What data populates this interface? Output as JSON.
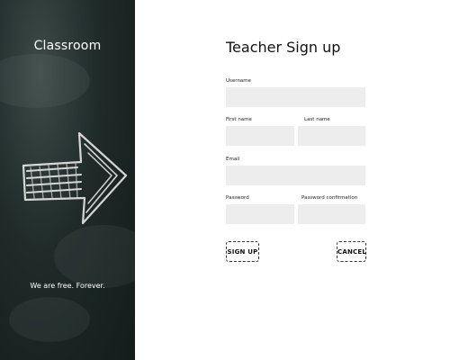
{
  "sidebar": {
    "brand": "Classroom",
    "tagline": "We are free. Forever."
  },
  "form": {
    "title": "Teacher Sign up",
    "username_label": "Username",
    "username_value": "",
    "first_name_label": "First name",
    "first_name_value": "",
    "last_name_label": "Last name",
    "last_name_value": "",
    "email_label": "Email",
    "email_value": "",
    "password_label": "Password",
    "password_value": "",
    "password_confirm_label": "Password confirmation",
    "password_confirm_value": "",
    "signup_label": "SIGN UP",
    "cancel_label": "CANCEL"
  },
  "colors": {
    "chalkboard": "#1f2a29",
    "input_bg": "#ededed",
    "text": "#111111"
  },
  "icons": {
    "hero": "chalk-arrow-icon"
  }
}
